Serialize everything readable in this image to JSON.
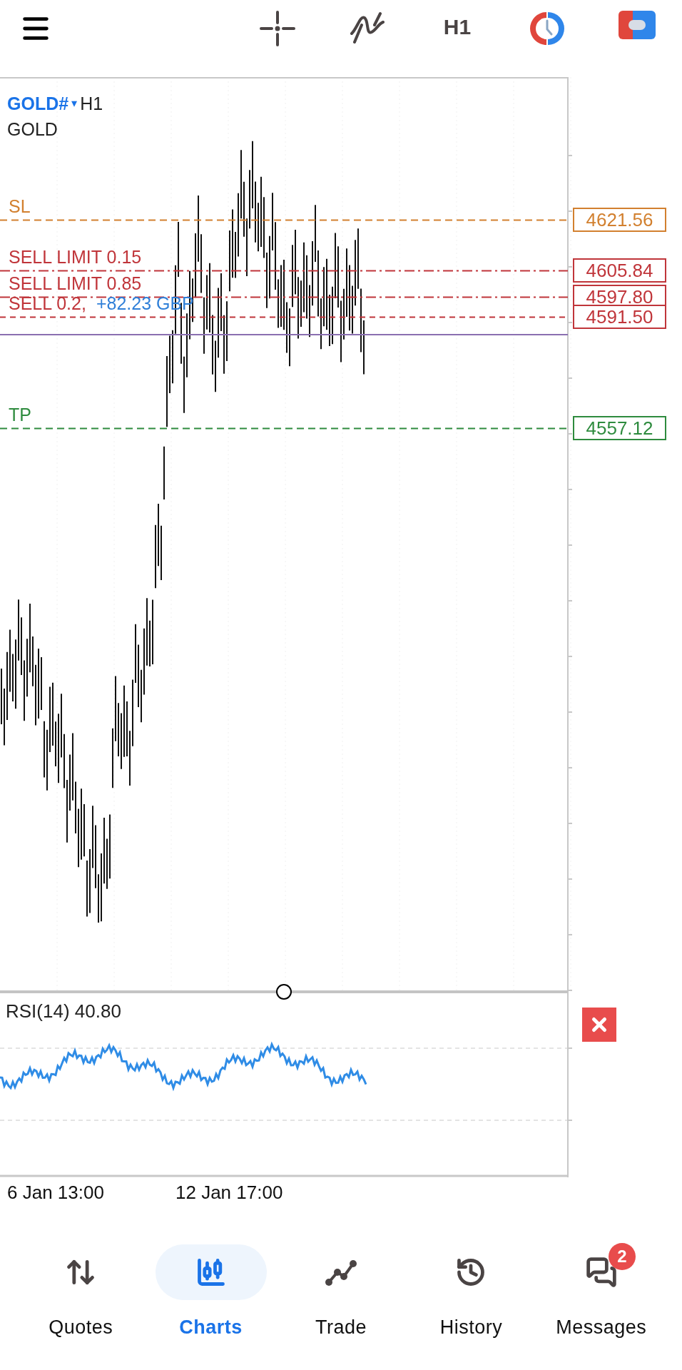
{
  "toolbar": {
    "timeframe": "H1"
  },
  "chart": {
    "symbol": "GOLD#",
    "dropdown": "▾",
    "timeframe": "H1",
    "description": "GOLD",
    "levels": [
      {
        "kind": "sl",
        "label": "SL",
        "price": "4621.56",
        "color": "#d2802f"
      },
      {
        "kind": "sell_limit",
        "label": "SELL LIMIT 0.15",
        "price": "4605.84",
        "color": "#c0353a"
      },
      {
        "kind": "sell_limit",
        "label": "SELL LIMIT 0.85",
        "price": "4597.80",
        "color": "#c0353a"
      },
      {
        "kind": "sell",
        "label": "SELL 0.2,",
        "profit": "+82.23 GBP",
        "price": "4591.50",
        "color": "#c0353a"
      },
      {
        "kind": "tp",
        "label": "TP",
        "price": "4557.12",
        "color": "#2e8b3e"
      }
    ]
  },
  "indicator": {
    "label": "RSI(14) 40.80"
  },
  "time_axis": [
    "6 Jan 13:00",
    "12 Jan 17:00"
  ],
  "nav": [
    {
      "kind": "quotes",
      "label": "Quotes",
      "selected": false
    },
    {
      "kind": "charts",
      "label": "Charts",
      "selected": true
    },
    {
      "kind": "trade",
      "label": "Trade",
      "selected": false
    },
    {
      "kind": "history",
      "label": "History",
      "selected": false
    },
    {
      "kind": "messages",
      "label": "Messages",
      "selected": false,
      "badge": "2"
    }
  ]
}
